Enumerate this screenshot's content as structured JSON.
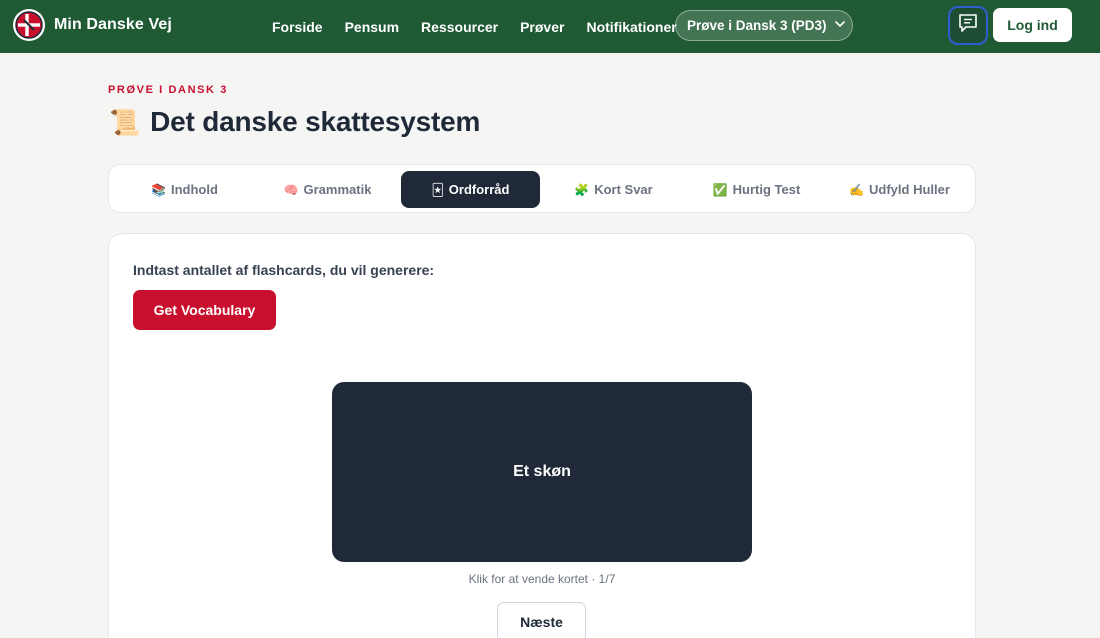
{
  "brand": {
    "name": "Min Danske Vej",
    "logo_icon": "danish-flag-heart-logo"
  },
  "nav": {
    "links": [
      {
        "label": "Forside"
      },
      {
        "label": "Pensum"
      },
      {
        "label": "Ressourcer"
      },
      {
        "label": "Prøver"
      },
      {
        "label": "Notifikationer"
      }
    ],
    "exam_selector": {
      "label": "Prøve i Dansk 3 (PD3)",
      "icon": "chevron-down-icon"
    },
    "chat_icon": "chat-message-icon",
    "login_label": "Log ind"
  },
  "header": {
    "eyebrow": "PRØVE I DANSK 3",
    "icon": "📜",
    "title": "Det danske skattesystem"
  },
  "tabs": [
    {
      "icon": "📚",
      "label": "Indhold",
      "active": false
    },
    {
      "icon": "🧠",
      "label": "Grammatik",
      "active": false
    },
    {
      "icon": "🃏",
      "label": "Ordforråd",
      "active": true
    },
    {
      "icon": "🧩",
      "label": "Kort Svar",
      "active": false
    },
    {
      "icon": "✅",
      "label": "Hurtig Test",
      "active": false
    },
    {
      "icon": "✍️",
      "label": "Udfyld Huller",
      "active": false
    }
  ],
  "vocab": {
    "prompt": "Indtast antallet af flashcards, du vil generere:",
    "button_label": "Get Vocabulary",
    "flashcard_word": "Et skøn",
    "hint_text": "Klik for at vende kortet · 1/7",
    "next_label": "Næste"
  },
  "colors": {
    "topbar": "#1f5a34",
    "accent_red": "#c8102e",
    "dark": "#1f2937",
    "page_bg": "#f5f5f4"
  }
}
